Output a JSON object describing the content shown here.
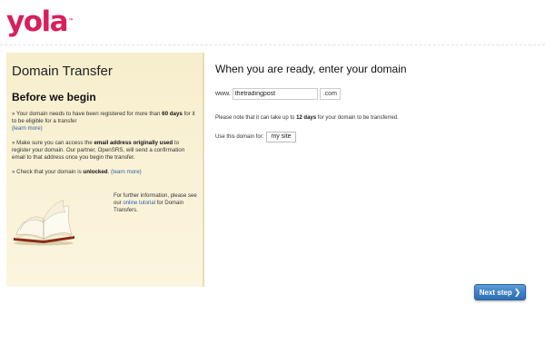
{
  "header": {
    "logo_text": "yola",
    "logo_tm": "™",
    "brand_color": "#d81e5b"
  },
  "left_panel": {
    "title": "Domain Transfer",
    "subtitle": "Before we begin",
    "bullet1": {
      "prefix": "» Your domain needs to have been registered for more than ",
      "bold": "60 days",
      "suffix": " for it to be eligible for a transfer",
      "link": "(learn more)"
    },
    "bullet2": {
      "prefix": "» Make sure you can access the ",
      "bold": "email address originally used",
      "suffix": " to register your domain. Our partner, OpenSRS, will send a confirmation email to that address once you begin the transfer."
    },
    "bullet3": {
      "prefix": "» Check that your domain is ",
      "bold": "unlocked",
      "suffix": ". ",
      "link": "(learn more)"
    },
    "further_info": {
      "prefix": "For further information, please see our ",
      "link": "online tutorial",
      "suffix": " for Domain Transfers."
    },
    "background_color": "#f9f1d4"
  },
  "main": {
    "heading": "When you are ready, enter your domain",
    "domain_prefix": "www.",
    "domain_value": "thetradingpost",
    "tld": ".com",
    "note_prefix": "Please note that it can take up to ",
    "note_bold": "12 days",
    "note_suffix": " for your domain to be transferred.",
    "use_label": "Use this domain for:",
    "use_value": "my site"
  },
  "actions": {
    "next_label": "Next step",
    "next_color": "#3d7fc4"
  }
}
